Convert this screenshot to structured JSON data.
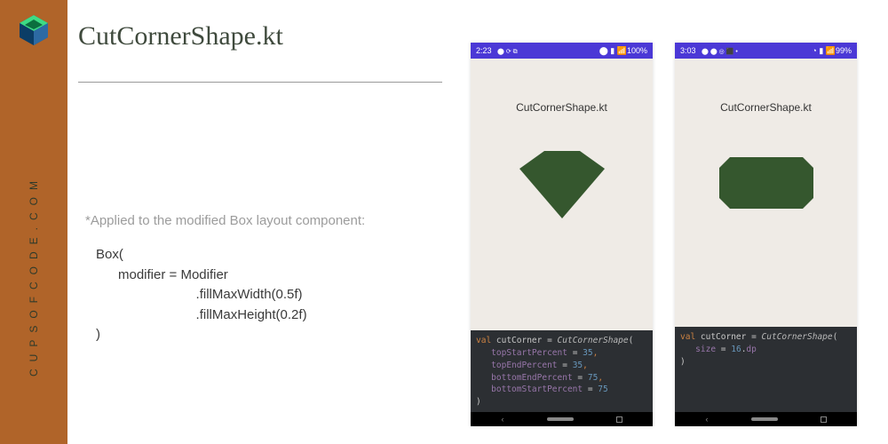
{
  "sidebar": {
    "site": "CUPSOFCODE.COM"
  },
  "title": "CutCornerShape.kt",
  "note": "*Applied to the modified Box layout component:",
  "box_code": "Box(\n      modifier = Modifier\n                           .fillMaxWidth(0.5f)\n                           .fillMaxHeight(0.2f)\n)",
  "phone1": {
    "time": "2:23",
    "status_left_icons": "⬤  ⟳  ⧉",
    "status_right": "⬤ ▮ 📶100%",
    "heading": "CutCornerShape.kt",
    "code": {
      "l1a": "val",
      "l1b": " cutCorner = ",
      "l1c": "CutCornerShape",
      "l1d": "(",
      "l2a": "topStartPercent",
      "l2b": " = ",
      "l2c": "35",
      "l2d": ",",
      "l3a": "topEndPercent",
      "l3b": " = ",
      "l3c": "35",
      "l3d": ",",
      "l4a": "bottomEndPercent",
      "l4b": " = ",
      "l4c": "75",
      "l4d": ",",
      "l5a": "bottomStartPercent",
      "l5b": " = ",
      "l5c": "75",
      "l6": ")"
    }
  },
  "phone2": {
    "time": "3:03",
    "status_left_icons": "⬤ ⬤ ◎ ⬛ •",
    "status_right": "◔ ▮ 📶99%",
    "heading": "CutCornerShape.kt",
    "code": {
      "l1a": "val",
      "l1b": " cutCorner = ",
      "l1c": "CutCornerShape",
      "l1d": "(",
      "l2a": "size",
      "l2b": " = ",
      "l2c": "16",
      "l2d": ".",
      "l2e": "dp",
      "l3": ")"
    }
  }
}
